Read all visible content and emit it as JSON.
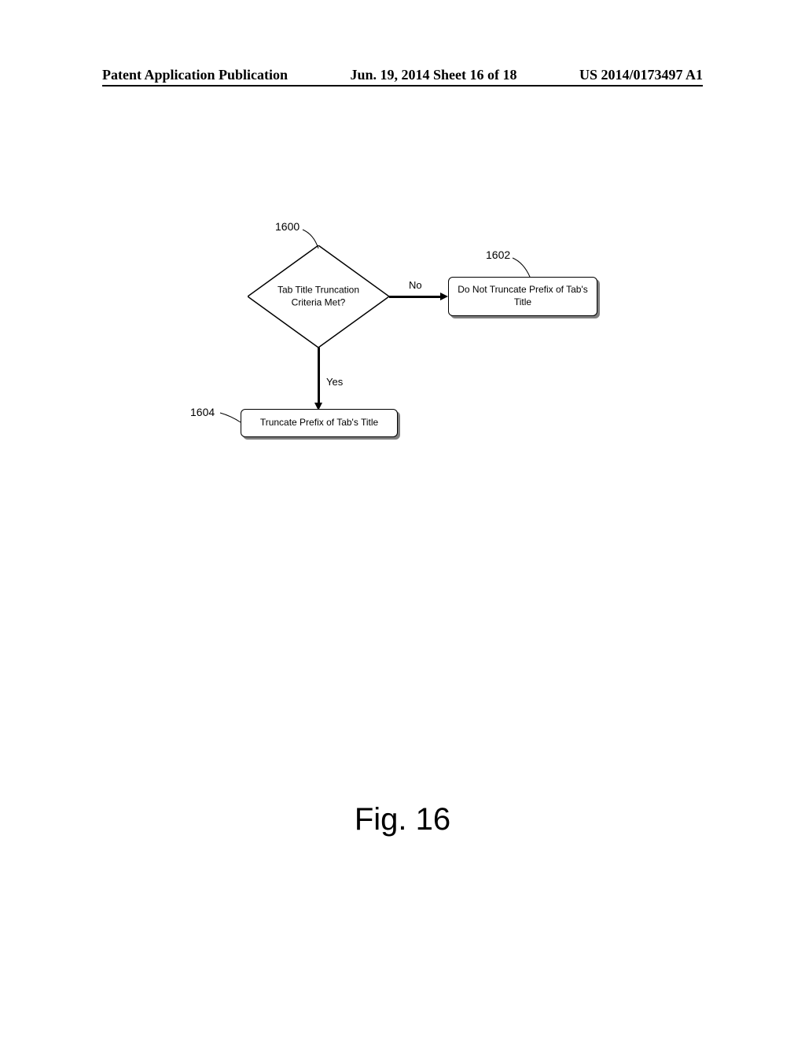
{
  "header": {
    "left": "Patent Application Publication",
    "center": "Jun. 19, 2014  Sheet 16 of 18",
    "right": "US 2014/0173497 A1"
  },
  "flowchart": {
    "decision": {
      "ref": "1600",
      "text": "Tab Title Truncation Criteria Met?"
    },
    "no_branch": {
      "label": "No",
      "ref": "1602",
      "text": "Do Not Truncate Prefix of Tab's Title"
    },
    "yes_branch": {
      "label": "Yes",
      "ref": "1604",
      "text": "Truncate Prefix of Tab's Title"
    }
  },
  "figure_caption": "Fig. 16"
}
